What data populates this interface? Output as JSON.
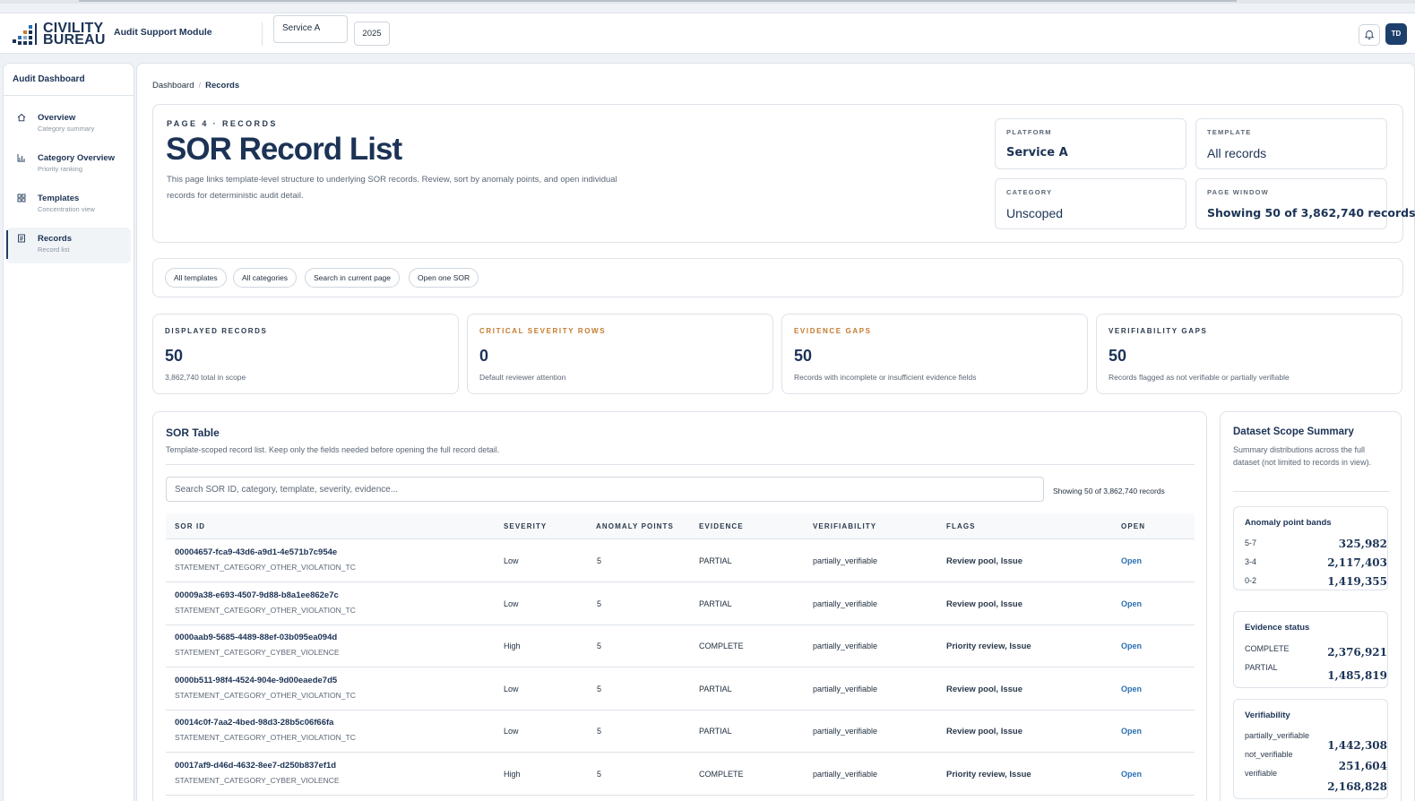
{
  "header": {
    "logo_line1": "CIVILITY",
    "logo_line2": "BUREAU",
    "module_title": "Audit Support Module",
    "service_value": "Service A",
    "year_value": "2025",
    "avatar_initials": "TD"
  },
  "sidebar": {
    "title": "Audit Dashboard",
    "items": [
      {
        "label": "Overview",
        "sub": "Category summary",
        "icon": "home-icon"
      },
      {
        "label": "Category Overview",
        "sub": "Priority ranking",
        "icon": "bar-chart-icon"
      },
      {
        "label": "Templates",
        "sub": "Concentration view",
        "icon": "grid-icon"
      },
      {
        "label": "Records",
        "sub": "Record list",
        "icon": "document-icon"
      }
    ]
  },
  "breadcrumb": {
    "root": "Dashboard",
    "current": "Records"
  },
  "hero": {
    "eyebrow": "PAGE 4 · RECORDS",
    "title": "SOR Record List",
    "description": "This page links template-level structure to underlying SOR records. Review, sort by anomaly points, and open individual records for deterministic audit detail.",
    "meta": [
      {
        "label": "PLATFORM",
        "value": "Service A"
      },
      {
        "label": "TEMPLATE",
        "value": "All records"
      },
      {
        "label": "CATEGORY",
        "value": "Unscoped"
      },
      {
        "label": "PAGE WINDOW",
        "value": "Showing 50 of 3,862,740 records"
      }
    ]
  },
  "filters": [
    "All templates",
    "All categories",
    "Search in current page",
    "Open one SOR"
  ],
  "stats": [
    {
      "label": "DISPLAYED RECORDS",
      "value": "50",
      "sub": "3,862,740 total in scope"
    },
    {
      "label": "CRITICAL SEVERITY ROWS",
      "value": "0",
      "sub": "Default reviewer attention"
    },
    {
      "label": "EVIDENCE GAPS",
      "value": "50",
      "sub": "Records with incomplete or insufficient evidence fields"
    },
    {
      "label": "VERIFIABILITY GAPS",
      "value": "50",
      "sub": "Records flagged as not verifiable or partially verifiable"
    }
  ],
  "table": {
    "title": "SOR Table",
    "subtitle": "Template-scoped record list. Keep only the fields needed before opening the full record detail.",
    "search_placeholder": "Search SOR ID, category, template, severity, evidence...",
    "showing": "Showing 50 of 3,862,740 records",
    "columns": [
      "SOR ID",
      "SEVERITY",
      "ANOMALY POINTS",
      "EVIDENCE",
      "VERIFIABILITY",
      "FLAGS",
      "OPEN"
    ],
    "rows": [
      {
        "id": "00004657-fca9-43d6-a9d1-4e571b7c954e",
        "category": "STATEMENT_CATEGORY_OTHER_VIOLATION_TC",
        "severity": "Low",
        "points": "5",
        "evidence": "PARTIAL",
        "verifiability": "partially_verifiable",
        "flags": "Review pool, Issue",
        "open": "Open"
      },
      {
        "id": "00009a38-e693-4507-9d88-b8a1ee862e7c",
        "category": "STATEMENT_CATEGORY_OTHER_VIOLATION_TC",
        "severity": "Low",
        "points": "5",
        "evidence": "PARTIAL",
        "verifiability": "partially_verifiable",
        "flags": "Review pool, Issue",
        "open": "Open"
      },
      {
        "id": "0000aab9-5685-4489-88ef-03b095ea094d",
        "category": "STATEMENT_CATEGORY_CYBER_VIOLENCE",
        "severity": "High",
        "points": "5",
        "evidence": "COMPLETE",
        "verifiability": "partially_verifiable",
        "flags": "Priority review, Issue",
        "open": "Open"
      },
      {
        "id": "0000b511-98f4-4524-904e-9d00eaede7d5",
        "category": "STATEMENT_CATEGORY_OTHER_VIOLATION_TC",
        "severity": "Low",
        "points": "5",
        "evidence": "PARTIAL",
        "verifiability": "partially_verifiable",
        "flags": "Review pool, Issue",
        "open": "Open"
      },
      {
        "id": "00014c0f-7aa2-4bed-98d3-28b5c06f66fa",
        "category": "STATEMENT_CATEGORY_OTHER_VIOLATION_TC",
        "severity": "Low",
        "points": "5",
        "evidence": "PARTIAL",
        "verifiability": "partially_verifiable",
        "flags": "Review pool, Issue",
        "open": "Open"
      },
      {
        "id": "00017af9-d46d-4632-8ee7-d250b837ef1d",
        "category": "STATEMENT_CATEGORY_CYBER_VIOLENCE",
        "severity": "High",
        "points": "5",
        "evidence": "COMPLETE",
        "verifiability": "partially_verifiable",
        "flags": "Priority review, Issue",
        "open": "Open"
      }
    ]
  },
  "scope": {
    "title": "Dataset Scope Summary",
    "description": "Summary distributions across the full dataset (not limited to records in view).",
    "anomaly": {
      "title": "Anomaly point bands",
      "rows": [
        {
          "key": "5-7",
          "value": "325,982"
        },
        {
          "key": "3-4",
          "value": "2,117,403"
        },
        {
          "key": "0-2",
          "value": "1,419,355"
        }
      ]
    },
    "evidence": {
      "title": "Evidence status",
      "rows": [
        {
          "key": "COMPLETE",
          "value": "2,376,921"
        },
        {
          "key": "PARTIAL",
          "value": "1,485,819"
        }
      ]
    },
    "verifiability": {
      "title": "Verifiability",
      "rows": [
        {
          "key": "partially_verifiable",
          "value": "1,442,308"
        },
        {
          "key": "not_verifiable",
          "value": "251,604"
        },
        {
          "key": "verifiable",
          "value": "2,168,828"
        }
      ]
    }
  },
  "colors": {
    "brand": "#1c3356",
    "accent": "#2a6fb0",
    "warning": "#c47a2c"
  }
}
